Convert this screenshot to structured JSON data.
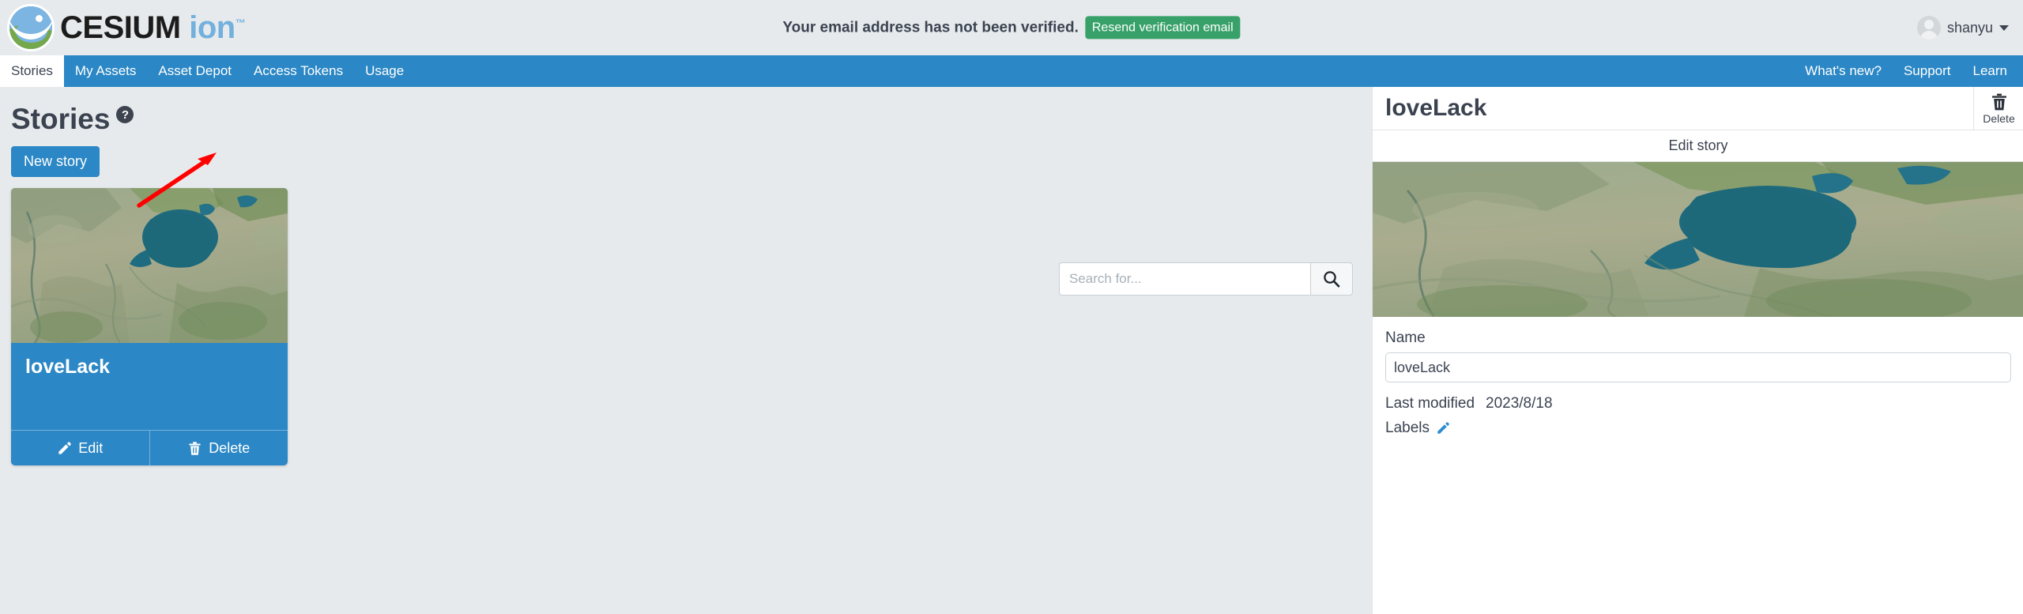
{
  "header": {
    "logo_text": "CESIUM",
    "logo_text_accent": "ion",
    "logo_tm": "™",
    "logo_icon": "cesium-mountain-icon",
    "verification_message": "Your email address has not been verified.",
    "resend_button": "Resend verification email",
    "user_name": "shanyu",
    "avatar_icon": "user-avatar-icon",
    "caret_icon": "chevron-down-icon"
  },
  "nav": {
    "left_items": [
      {
        "label": "Stories",
        "active": true
      },
      {
        "label": "My Assets",
        "active": false
      },
      {
        "label": "Asset Depot",
        "active": false
      },
      {
        "label": "Access Tokens",
        "active": false
      },
      {
        "label": "Usage",
        "active": false
      }
    ],
    "right_items": [
      {
        "label": "What's new?"
      },
      {
        "label": "Support"
      },
      {
        "label": "Learn"
      }
    ]
  },
  "stories": {
    "title": "Stories",
    "help_icon_label": "?",
    "new_story_button": "New story",
    "search_placeholder": "Search for...",
    "search_value": "",
    "search_icon": "search-icon",
    "cards": [
      {
        "name": "loveLack",
        "edit_label": "Edit",
        "delete_label": "Delete",
        "edit_icon": "pencil-icon",
        "delete_icon": "trash-icon",
        "thumbnail": "satellite-map-thumbnail"
      }
    ]
  },
  "annotation": {
    "type": "red-arrow",
    "color": "#ff0000",
    "points_to": "Access Tokens"
  },
  "detail_panel": {
    "title": "loveLack",
    "delete_label": "Delete",
    "delete_icon": "trash-icon",
    "edit_story_label": "Edit story",
    "preview_image": "satellite-map-preview",
    "name_label": "Name",
    "name_value": "loveLack",
    "last_modified_label": "Last modified",
    "last_modified_value": "2023/8/18",
    "labels_label": "Labels",
    "labels_edit_icon": "pencil-icon"
  },
  "colors": {
    "brand_blue": "#2b87c5",
    "page_background": "#e7eaec",
    "success_green": "#38a169",
    "text_dark": "#3b4351",
    "annotation_red": "#ff0000"
  }
}
